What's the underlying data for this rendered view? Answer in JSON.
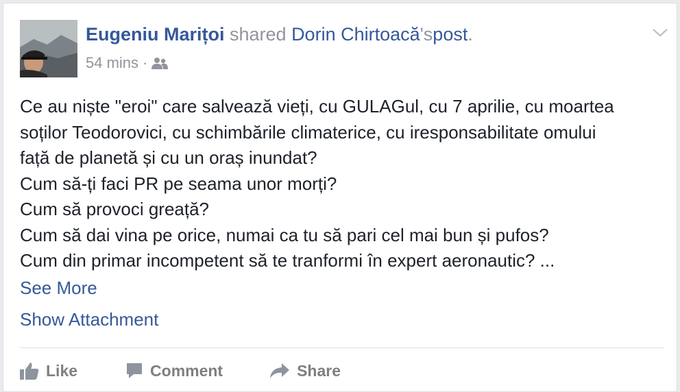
{
  "post": {
    "author": "Eugeniu Marițoi",
    "shared_text": " shared ",
    "original_author": "Dorin Chirtoacă",
    "possessive": "'s",
    "post_link": "post",
    "period": ".",
    "timestamp": "54 mins",
    "separator": "·",
    "audience_icon": "friends-icon",
    "body_lines": [
      "Ce au niște \"eroi\" care salvează vieți, cu GULAGul, cu 7 aprilie, cu moartea",
      "soților Teodorovici, cu schimbările climaterice, cu iresponsabilitate omului",
      "față de planetă și cu un oraș inundat?",
      "Cum să-ți faci PR pe seama unor morți?",
      "Cum să provoci greață?",
      "Cum să dai vina pe orice, numai ca tu să pari cel mai bun și pufos?",
      "Cum din primar incompetent să te tranformi în expert aeronautic? ..."
    ],
    "see_more": "See More",
    "show_attachment": "Show Attachment"
  },
  "actions": {
    "like": "Like",
    "comment": "Comment",
    "share": "Share"
  },
  "colors": {
    "link": "#365899",
    "meta": "#90949c",
    "text": "#1d2129",
    "action": "#7f7f7f",
    "background": "#e9ebee"
  }
}
